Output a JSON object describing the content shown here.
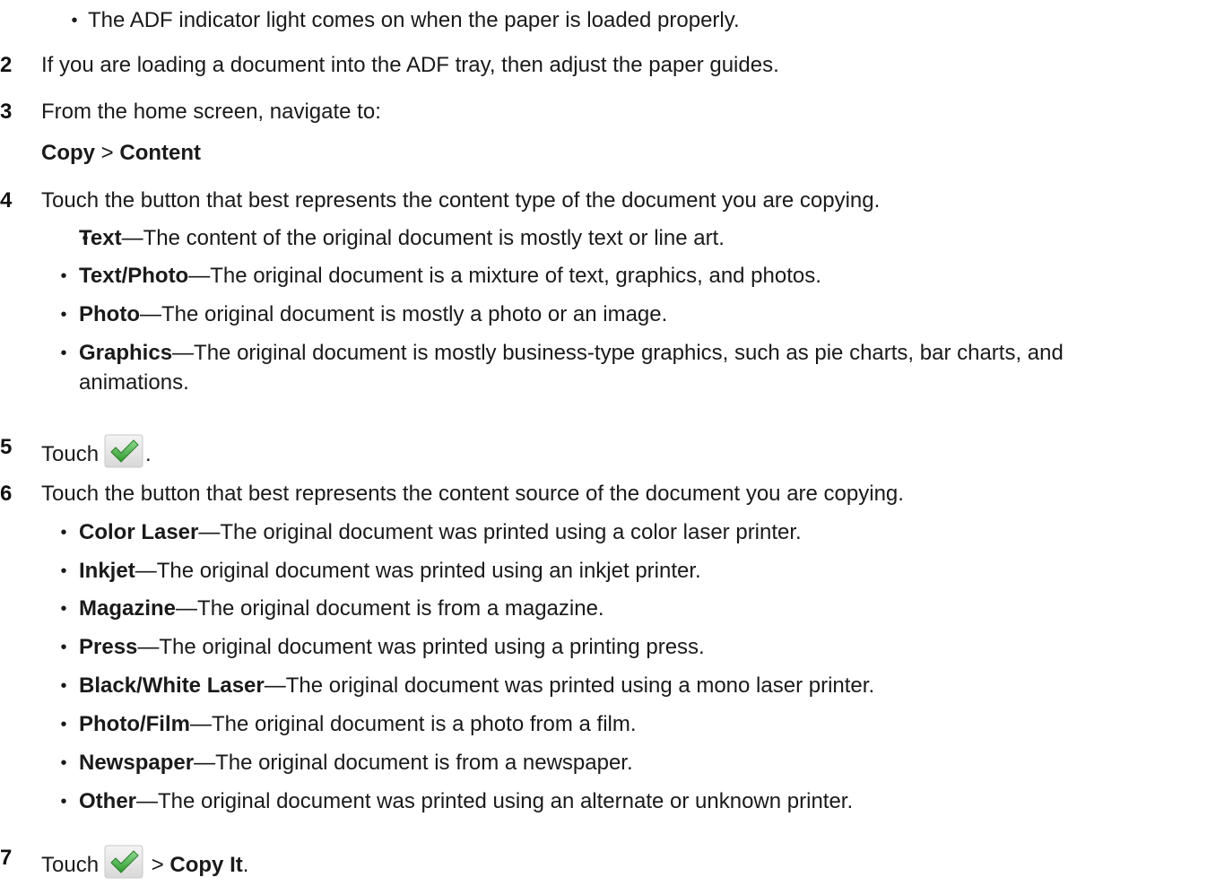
{
  "intro_bullet": "The ADF indicator light comes on when the paper is loaded properly.",
  "steps": [
    {
      "num": "2",
      "text": "If you are loading a document into the ADF tray, then adjust the paper guides."
    },
    {
      "num": "3",
      "text": "From the home screen, navigate to:",
      "nav_a": "Copy",
      "nav_sep": " > ",
      "nav_b": "Content"
    },
    {
      "num": "4",
      "text": "Touch the button that best represents the content type of the document you are copying."
    },
    {
      "num": "5",
      "text": "Touch",
      "after": "."
    },
    {
      "num": "6",
      "text": "Touch the button that best represents the content source of the document you are copying."
    },
    {
      "num": "7",
      "text": "Touch",
      "sep": " > ",
      "bold": "Copy It",
      "after": "."
    }
  ],
  "content_types": [
    {
      "term": "Text",
      "desc": "—The content of the original document is mostly text or line art."
    },
    {
      "term": "Text/Photo",
      "desc": "—The original document is a mixture of text, graphics, and photos."
    },
    {
      "term": "Photo",
      "desc": "—The original document is mostly a photo or an image."
    },
    {
      "term": "Graphics",
      "desc": "—The original document is mostly business-type graphics, such as pie charts, bar charts, and",
      "desc2": "animations."
    }
  ],
  "content_sources": [
    {
      "term": "Color Laser",
      "desc": "—The original document was printed using a color laser printer."
    },
    {
      "term": "Inkjet",
      "desc": "—The original document was printed using an inkjet printer."
    },
    {
      "term": "Magazine",
      "desc": "—The original document is from a magazine."
    },
    {
      "term": "Press",
      "desc": "—The original document was printed using a printing press."
    },
    {
      "term": "Black/White Laser",
      "desc": "—The original document was printed using a mono laser printer."
    },
    {
      "term": "Photo/Film",
      "desc": "—The original document is a photo from a film."
    },
    {
      "term": "Newspaper",
      "desc": "—The original document is from a newspaper."
    },
    {
      "term": "Other",
      "desc": "—The original document was printed using an alternate or unknown printer."
    }
  ],
  "icons": {
    "check": "check-submit-icon"
  },
  "colors": {
    "text": "#1a1a1a",
    "check_green": "#3fae3f"
  }
}
